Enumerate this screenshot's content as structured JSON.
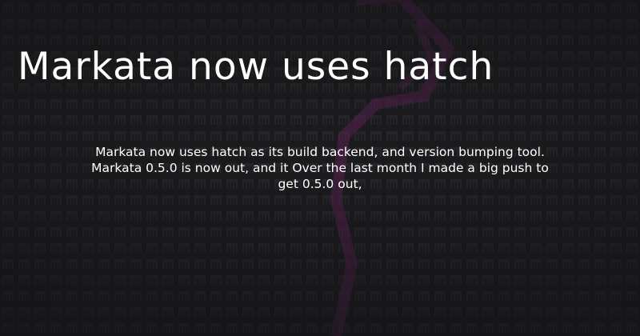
{
  "title": "Markata now uses hatch",
  "description": "Markata now uses hatch as its build backend, and version bumping tool. Markata 0.5.0 is now out, and it Over the last month I made a big push to get 0.5.0 out,",
  "colors": {
    "background": "#1b1b1e",
    "tile_fill": "#2a2a2e",
    "tile_stroke": "#141416",
    "accent": "#7a2a6e",
    "text": "#ffffff"
  }
}
